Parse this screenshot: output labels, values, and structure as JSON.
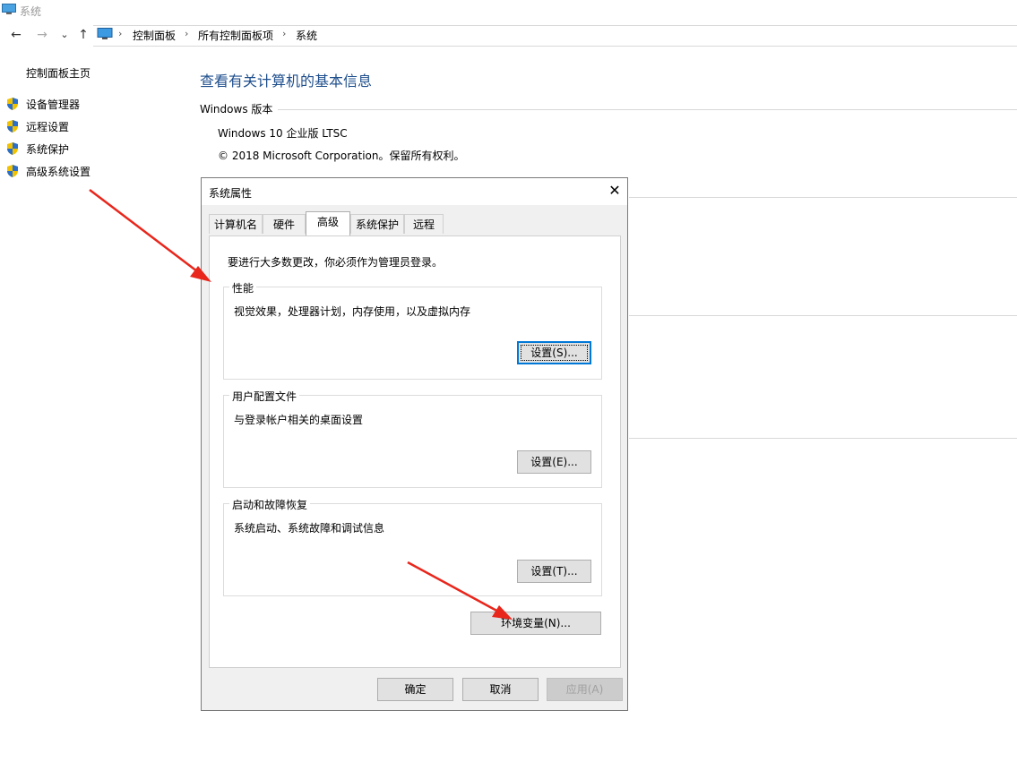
{
  "window": {
    "title": "系统",
    "title_icon": "monitor-icon"
  },
  "nav": {
    "back_icon": "←",
    "forward_icon": "→",
    "dropdown_icon": "⌄",
    "up_icon": "↑",
    "breadcrumbs": [
      "控制面板",
      "所有控制面板项",
      "系统"
    ],
    "separator": "›"
  },
  "sidebar": {
    "home": "控制面板主页",
    "items": [
      {
        "label": "设备管理器",
        "icon": "shield-icon"
      },
      {
        "label": "远程设置",
        "icon": "shield-icon"
      },
      {
        "label": "系统保护",
        "icon": "shield-icon"
      },
      {
        "label": "高级系统设置",
        "icon": "shield-icon"
      }
    ]
  },
  "main": {
    "title": "查看有关计算机的基本信息",
    "edition_label": "Windows 版本",
    "edition_value": "Windows 10 企业版 LTSC",
    "copyright": "© 2018 Microsoft Corporation。保留所有权利。"
  },
  "dialog": {
    "title": "系统属性",
    "close_icon": "✕",
    "tabs": [
      "计算机名",
      "硬件",
      "高级",
      "系统保护",
      "远程"
    ],
    "active_tab": "高级",
    "admin_note": "要进行大多数更改，你必须作为管理员登录。",
    "groups": {
      "performance": {
        "label": "性能",
        "desc": "视觉效果，处理器计划，内存使用，以及虚拟内存",
        "button": "设置(S)..."
      },
      "profiles": {
        "label": "用户配置文件",
        "desc": "与登录帐户相关的桌面设置",
        "button": "设置(E)..."
      },
      "startup": {
        "label": "启动和故障恢复",
        "desc": "系统启动、系统故障和调试信息",
        "button": "设置(T)..."
      }
    },
    "env_button": "环境变量(N)...",
    "ok_button": "确定",
    "cancel_button": "取消",
    "apply_button": "应用(A)"
  },
  "colors": {
    "title_blue": "#1e4e8c",
    "arrow_red": "#e8261c",
    "focus_blue": "#0078d7"
  }
}
